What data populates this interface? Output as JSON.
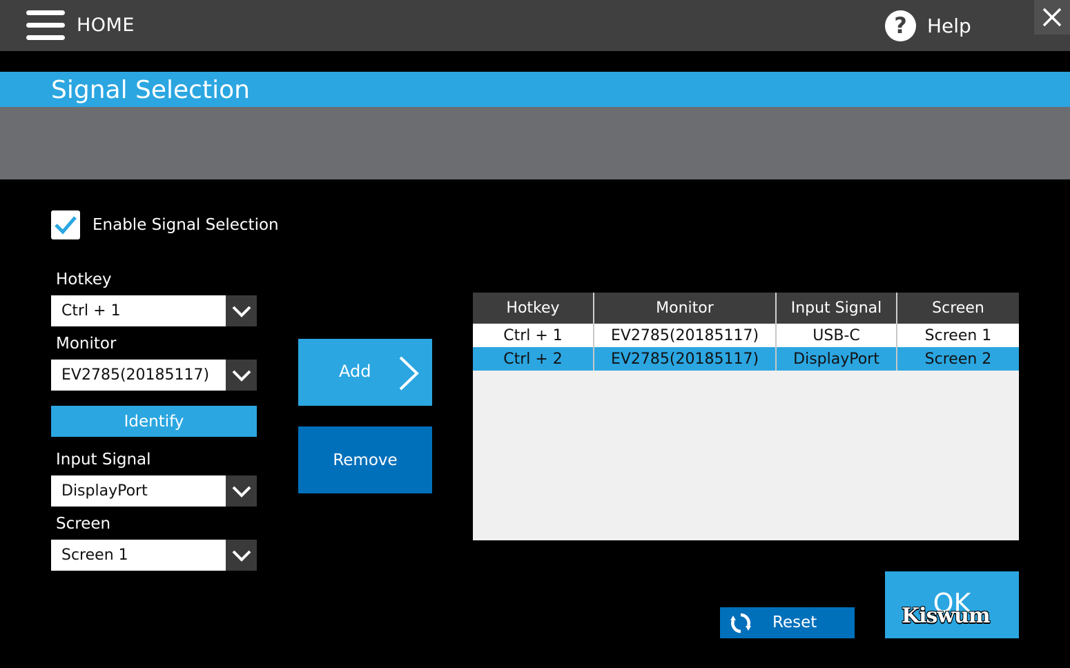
{
  "header": {
    "home_label": "HOME",
    "help_label": "Help"
  },
  "page": {
    "title": "Signal Selection"
  },
  "enable": {
    "label": "Enable Signal Selection",
    "checked": true
  },
  "form": {
    "hotkey_label": "Hotkey",
    "hotkey_value": "Ctrl + 1",
    "monitor_label": "Monitor",
    "monitor_value": "EV2785(20185117)",
    "identify_label": "Identify",
    "input_signal_label": "Input Signal",
    "input_signal_value": "DisplayPort",
    "screen_label": "Screen",
    "screen_value": "Screen 1"
  },
  "actions": {
    "add_label": "Add",
    "remove_label": "Remove",
    "reset_label": "Reset",
    "ok_label": "OK"
  },
  "table": {
    "columns": [
      "Hotkey",
      "Monitor",
      "Input Signal",
      "Screen"
    ],
    "rows": [
      {
        "hotkey": "Ctrl + 1",
        "monitor": "EV2785(20185117)",
        "input_signal": "USB-C",
        "screen": "Screen 1",
        "selected": false
      },
      {
        "hotkey": "Ctrl + 2",
        "monitor": "EV2785(20185117)",
        "input_signal": "DisplayPort",
        "screen": "Screen 2",
        "selected": true
      }
    ]
  },
  "watermark": "Kiswum",
  "colors": {
    "accent": "#2ba6e1",
    "button_dark_blue": "#0070bb",
    "topbar": "#404040",
    "grey_band": "#6c6d70"
  },
  "icons": {
    "menu": "hamburger-icon",
    "help": "question-circle-icon",
    "close": "close-icon",
    "checkbox": "checkmark-icon",
    "dropdown": "chevron-down-icon",
    "add": "chevron-right-icon",
    "reset": "refresh-icon"
  }
}
